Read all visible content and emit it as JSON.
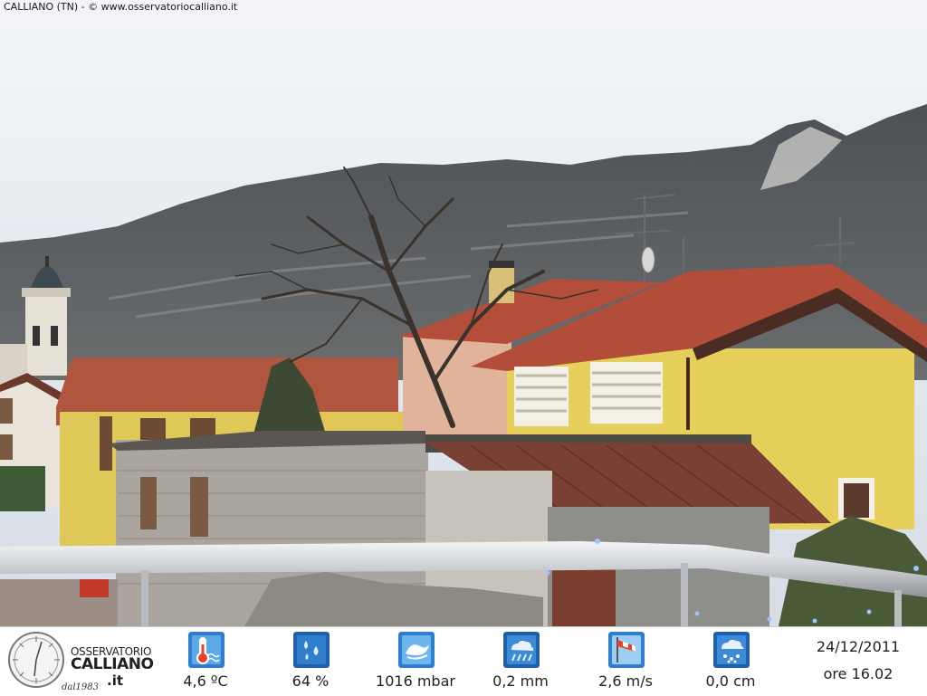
{
  "caption": "CALLIANO (TN) - © www.osservatoriocalliano.it",
  "logo": {
    "line1": "OSSERVATORIO",
    "line2": "CALLIANO",
    "line3": ".it",
    "since": "dal1983"
  },
  "measurements": [
    {
      "name": "temperature",
      "icon": "thermometer-icon",
      "value": "4,6 ºC"
    },
    {
      "name": "humidity",
      "icon": "water-drops-icon",
      "value": "64 %"
    },
    {
      "name": "pressure",
      "icon": "pressure-wave-icon",
      "value": "1016 mbar"
    },
    {
      "name": "rain",
      "icon": "rain-cloud-icon",
      "value": "0,2 mm"
    },
    {
      "name": "wind",
      "icon": "windsock-icon",
      "value": "2,6 m/s"
    },
    {
      "name": "snow",
      "icon": "snow-cloud-icon",
      "value": "0,0 cm"
    }
  ],
  "datetime": {
    "date": "24/12/2011",
    "time": "ore 16.02"
  },
  "colors": {
    "sky": "#dde3ea",
    "mountain": "#555a5e",
    "roof": "#a5503d",
    "wall_yellow": "#e2cc55",
    "icon_blue": "#2a78c8"
  }
}
